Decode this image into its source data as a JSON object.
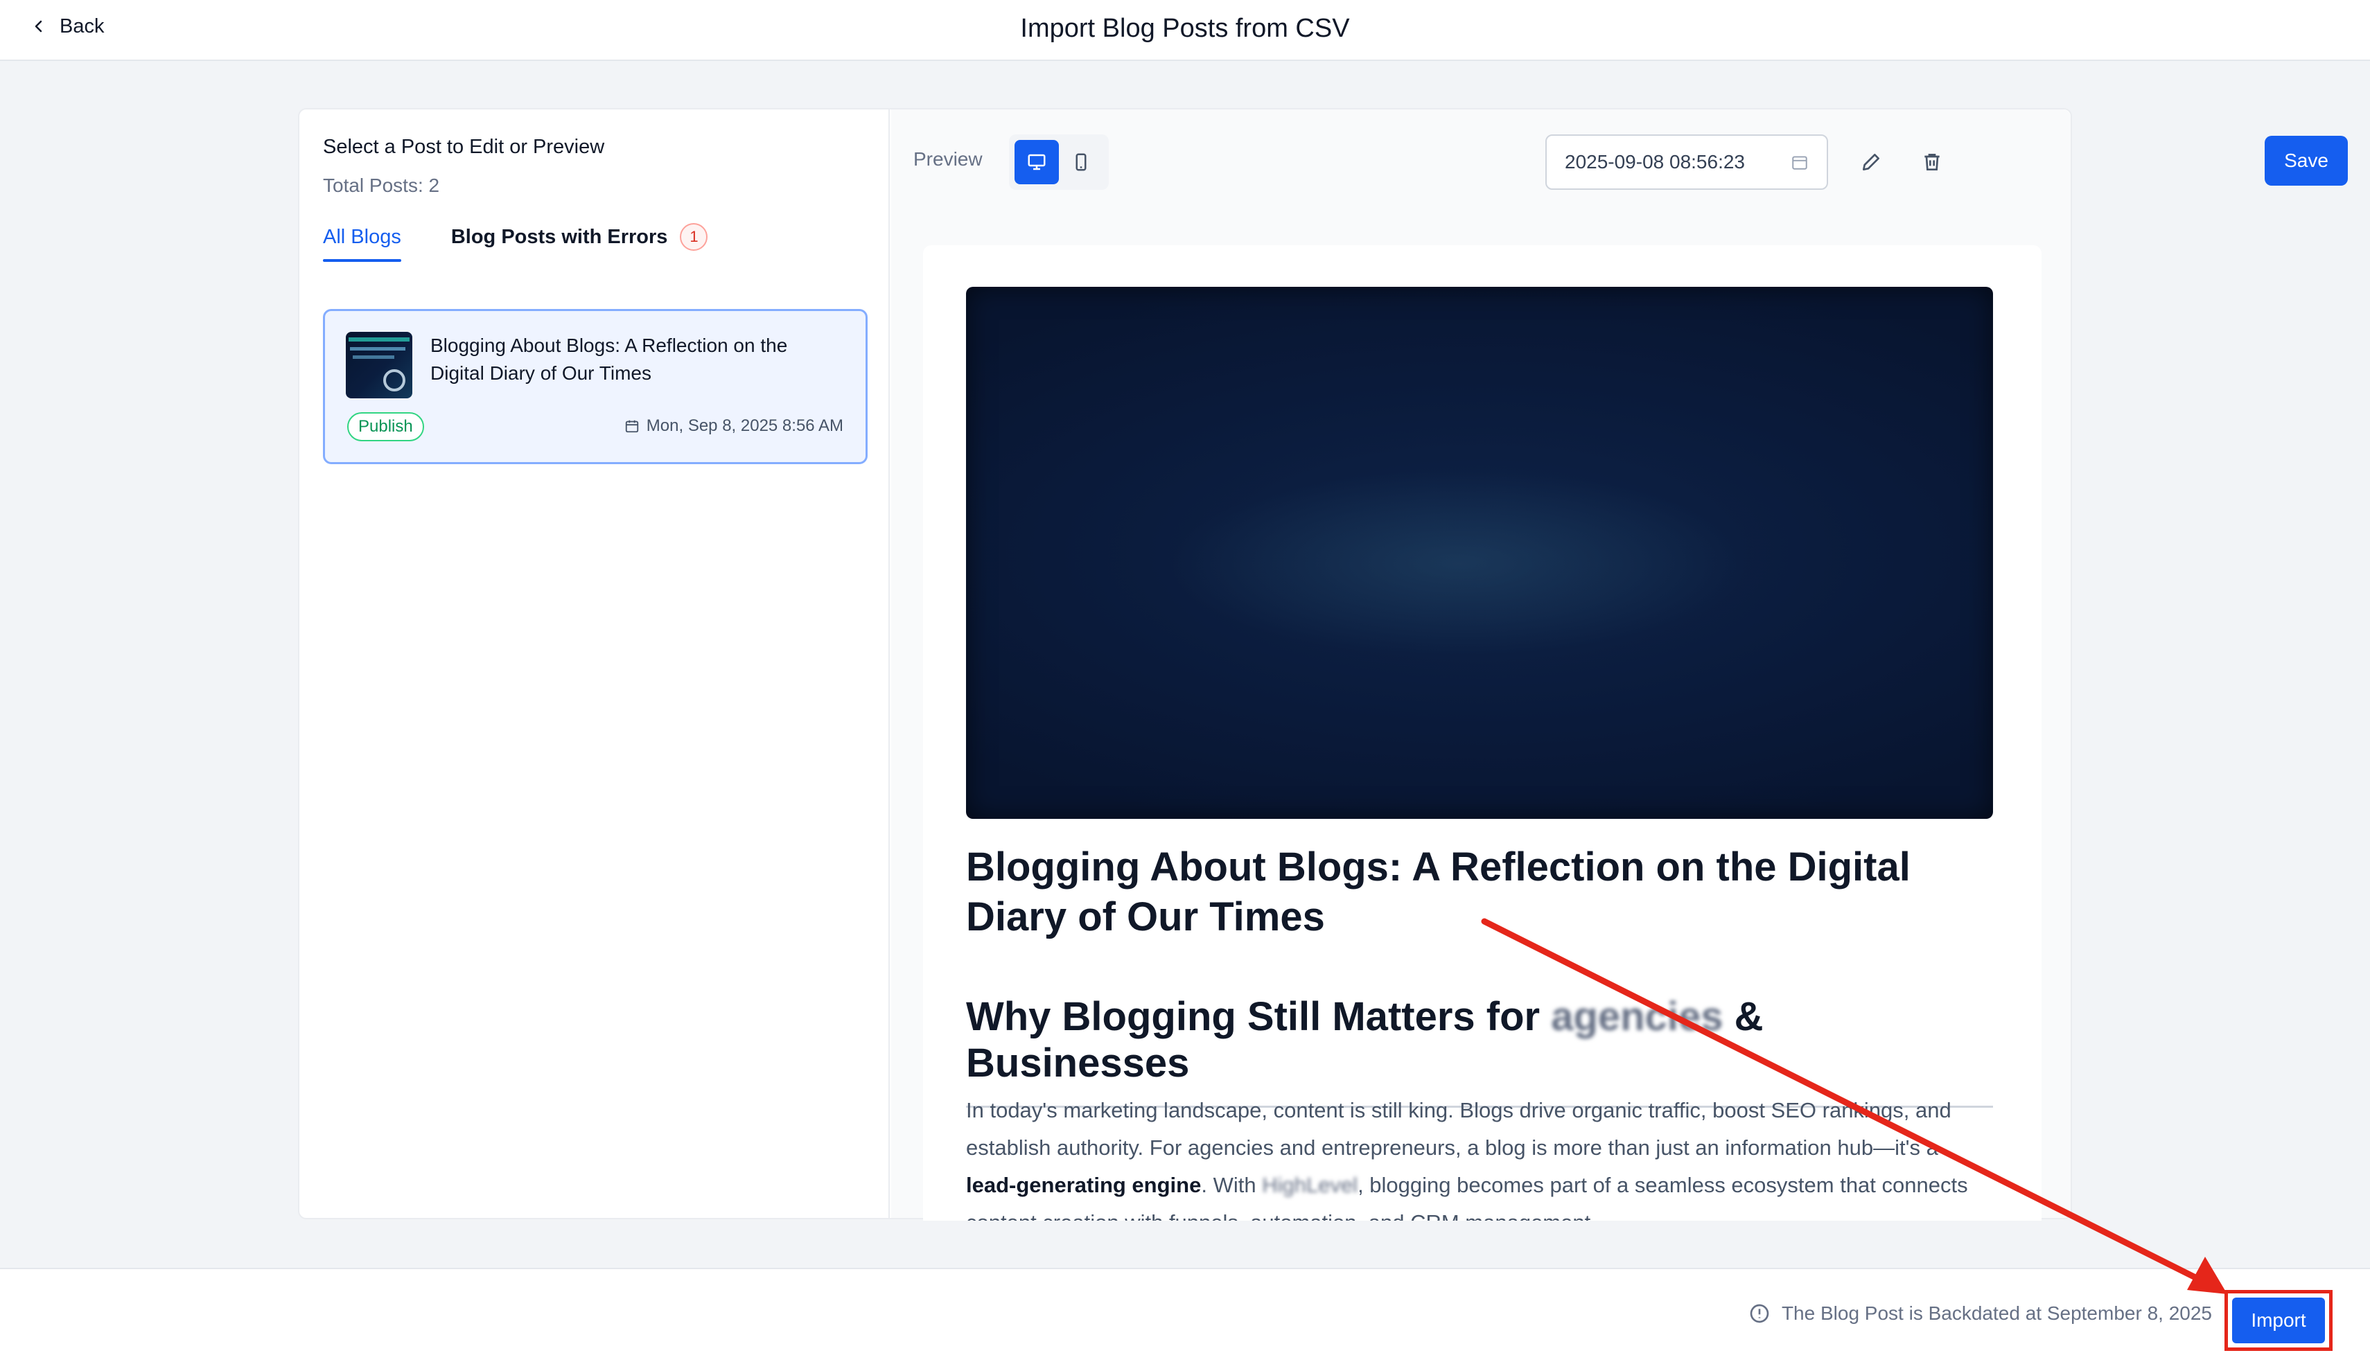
{
  "header": {
    "back_label": "Back",
    "title": "Import Blog Posts from CSV"
  },
  "left_panel": {
    "heading": "Select a Post to Edit or Preview",
    "total_posts": "Total Posts: 2",
    "tabs": [
      {
        "label": "All Blogs",
        "active": true
      },
      {
        "label": "Blog Posts with Errors",
        "badge": "1"
      }
    ],
    "posts": [
      {
        "title": "Blogging About Blogs: A Reflection on the Digital Diary of Our Times",
        "status": "Publish",
        "date": "Mon, Sep 8, 2025 8:56 AM"
      }
    ]
  },
  "toolbar": {
    "preview_label": "Preview",
    "datetime_value": "2025-09-08 08:56:23",
    "save_label": "Save"
  },
  "preview": {
    "title": "Blogging About Blogs: A Reflection on the Digital Diary of Our Times",
    "subheading_start": "Why Blogging Still Matters for",
    "subheading_redacted": "agencies",
    "subheading_end": "& Businesses",
    "paragraph_part1": "In today's marketing landscape, content is still king. Blogs drive organic traffic, boost SEO rankings, and establish authority. For agencies and entrepreneurs, a blog is more than just an information hub—it's a",
    "paragraph_bold": "lead-generating engine",
    "paragraph_part2": ". With",
    "paragraph_redacted": "HighLevel",
    "paragraph_part3": ", blogging becomes part of a seamless ecosystem that connects content creation with funnels, automation, and CRM management."
  },
  "footer": {
    "note": "The Blog Post is Backdated at September 8, 2025",
    "import_label": "Import"
  },
  "colors": {
    "primary": "#155eef",
    "annotation": "#e5261a",
    "publish_green": "#079455"
  }
}
